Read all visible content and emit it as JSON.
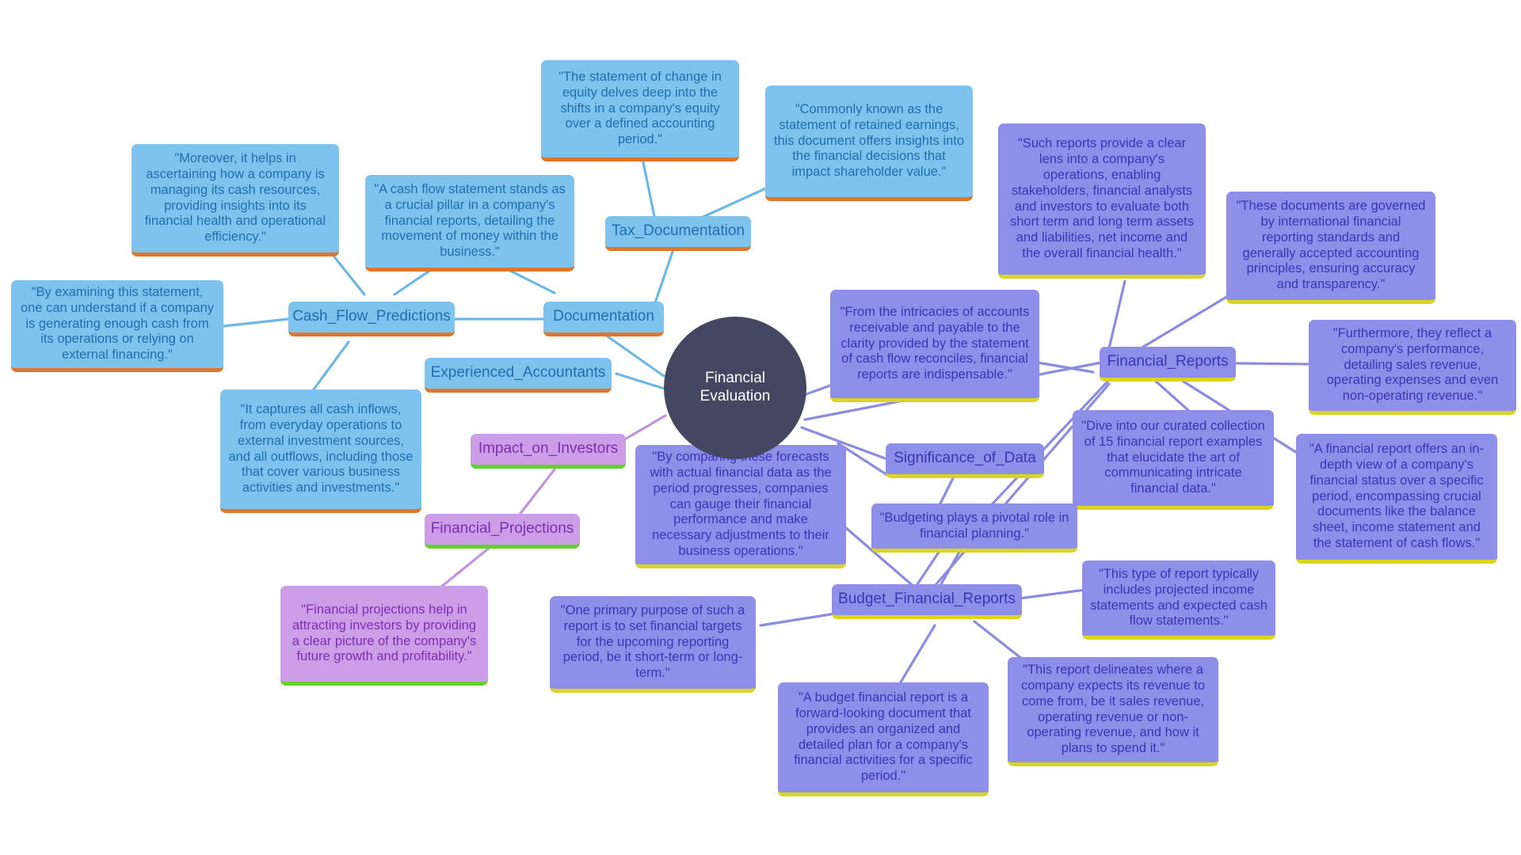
{
  "diagram": {
    "title": "Financial Evaluation",
    "type": "mind-map",
    "palette": {
      "background": "#ffffff",
      "root_fill": "#434761",
      "root_text": "#ffffff",
      "blue_fill": "#7ec2ee",
      "blue_text": "#1f6fab",
      "blue_accent": "#e0762a",
      "purple_fill": "#8e8fe8",
      "purple_text": "#3b35b4",
      "purple_accent": "#dbd420",
      "pink_fill": "#cd9de8",
      "pink_text": "#7b2fb0",
      "pink_accent": "#63d12c",
      "edge_blue": "#6cb8e4",
      "edge_purple": "#8b8ce0",
      "edge_pink": "#c493dd"
    },
    "root": {
      "label": "Financial Evaluation"
    },
    "topics": {
      "cash_flow_predictions": "Cash_Flow_Predictions",
      "documentation": "Documentation",
      "tax_documentation": "Tax_Documentation",
      "experienced_accountants": "Experienced_Accountants",
      "impact_on_investors": "Impact_on_Investors",
      "financial_projections": "Financial_Projections",
      "financial_reports": "Financial_Reports",
      "significance_of_data": "Significance_of_Data",
      "budget_financial_reports": "Budget_Financial_Reports"
    },
    "leaves": {
      "moreover_cash_resources": "\"Moreover, it helps in ascertaining how a company is managing its cash resources, providing insights into its financial health and operational efficiency.\"",
      "cash_flow_pillar": "\"A cash flow statement stands as a crucial pillar in a company's financial reports, detailing the movement of money within the business.\"",
      "statement_of_change_equity": "\"The statement of change in equity delves deep into the shifts in a company's equity over a defined accounting period.\"",
      "retained_earnings": "\"Commonly known as the statement of retained earnings, this document offers insights into the financial decisions that impact shareholder value.\"",
      "by_examining_statement": "\"By examining this statement, one can understand if a company is generating enough cash from its operations or relying on external financing.\"",
      "captures_cash_inflows": "\"It captures all cash inflows, from everyday operations to external investment sources, and all outflows, including those that cover various business activities and investments.\"",
      "by_comparing_forecasts": "\"By comparing these forecasts with actual financial data as the period progresses, companies can gauge their financial performance and make necessary adjustments to their business operations.\"",
      "financial_projections_investors": "\"Financial projections help in attracting investors by providing a clear picture of the company's future growth and profitability.\"",
      "intricacies_accounts_receivable": "\"From the intricacies of accounts receivable and payable to the clarity provided by the statement of cash flow reconciles, financial reports are indispensable.\"",
      "such_reports_clear_lens": "\"Such reports provide a clear lens into a company's operations, enabling stakeholders, financial analysts and investors to evaluate both short term and long term assets and liabilities, net income and the overall financial health.\"",
      "international_standards": "\"These documents are governed by international financial reporting standards and generally accepted accounting principles, ensuring accuracy and transparency.\"",
      "furthermore_performance": "\"Furthermore, they reflect a company's performance, detailing sales revenue, operating expenses and even non-operating revenue.\"",
      "curated_collection_15": "\"Dive into our curated collection of 15 financial report examples that elucidate the art of communicating intricate financial data.\"",
      "financial_report_in_depth": "\"A financial report offers an in-depth view of a company's financial status over a specific period, encompassing crucial documents like the balance sheet, income statement and the statement of cash flows.\"",
      "budgeting_pivotal_role": "\"Budgeting plays a pivotal role in financial planning.\"",
      "projected_income_statements": "\"This type of report typically includes projected income statements and expected cash flow statements.\"",
      "one_primary_purpose": "\"One primary purpose of such a report is to set financial targets for the upcoming reporting period, be it short-term or long-term.\"",
      "budget_forward_looking": "\"A budget financial report is a forward-looking document that provides an organized and detailed plan for a company's financial activities for a specific period.\"",
      "report_delineates_revenue": "\"This report delineates where a company expects its revenue to come from, be it sales revenue, operating revenue or non-operating revenue, and how it plans to spend it.\""
    }
  }
}
